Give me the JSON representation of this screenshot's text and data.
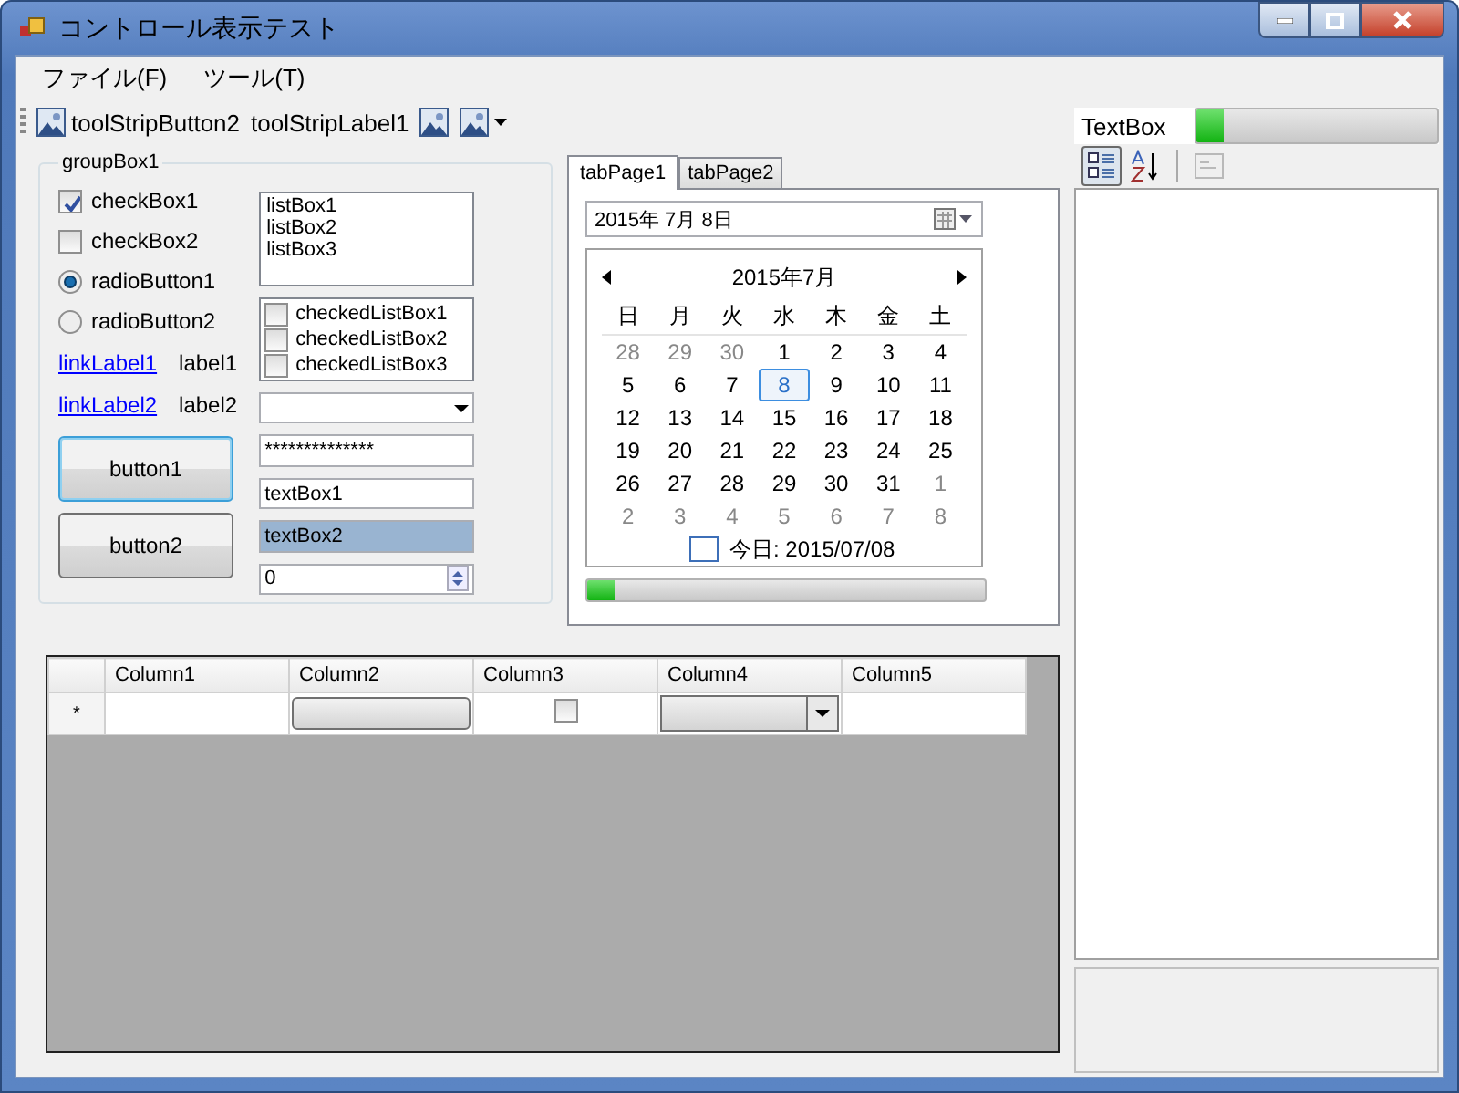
{
  "window": {
    "title": "コントロール表示テスト"
  },
  "menu": [
    {
      "label": "ファイル(F)"
    },
    {
      "label": "ツール(T)"
    }
  ],
  "toolstrip": [
    {
      "kind": "button",
      "label": "toolStripButton2"
    },
    {
      "kind": "label",
      "label": "toolStripLabel1"
    },
    {
      "kind": "image"
    },
    {
      "kind": "dropdown"
    }
  ],
  "group_box": {
    "title": "groupBox1",
    "checkboxes": [
      {
        "label": "checkBox1",
        "checked": true
      },
      {
        "label": "checkBox2",
        "checked": false
      }
    ],
    "radios": [
      {
        "label": "radioButton1",
        "selected": true
      },
      {
        "label": "radioButton2",
        "selected": false
      }
    ],
    "link_rows": [
      {
        "link": "linkLabel1",
        "label": "label1"
      },
      {
        "link": "linkLabel2",
        "label": "label2"
      }
    ],
    "buttons": [
      {
        "label": "button1",
        "focused": true
      },
      {
        "label": "button2",
        "focused": false
      }
    ],
    "list_box": [
      "listBox1",
      "listBox2",
      "listBox3"
    ],
    "checked_list_box": [
      {
        "label": "checkedListBox1",
        "checked": false
      },
      {
        "label": "checkedListBox2",
        "checked": false
      },
      {
        "label": "checkedListBox3",
        "checked": false
      }
    ],
    "password": "**************",
    "text_boxes": [
      {
        "value": "textBox1",
        "selected": false
      },
      {
        "value": "textBox2",
        "selected": true
      }
    ],
    "numeric": "0"
  },
  "tabs": [
    {
      "label": "tabPage1",
      "selected": true
    },
    {
      "label": "tabPage2",
      "selected": false
    }
  ],
  "date_picker": "2015年  7月  8日",
  "calendar": {
    "title": "2015年7月",
    "weekdays": [
      "日",
      "月",
      "火",
      "水",
      "木",
      "金",
      "土"
    ],
    "weeks": [
      [
        {
          "day": "28",
          "other": true,
          "selected": false
        },
        {
          "day": "29",
          "other": true,
          "selected": false
        },
        {
          "day": "30",
          "other": true,
          "selected": false
        },
        {
          "day": "1",
          "other": false,
          "selected": false
        },
        {
          "day": "2",
          "other": false,
          "selected": false
        },
        {
          "day": "3",
          "other": false,
          "selected": false
        },
        {
          "day": "4",
          "other": false,
          "selected": false
        }
      ],
      [
        {
          "day": "5",
          "other": false,
          "selected": false
        },
        {
          "day": "6",
          "other": false,
          "selected": false
        },
        {
          "day": "7",
          "other": false,
          "selected": false
        },
        {
          "day": "8",
          "other": false,
          "selected": true
        },
        {
          "day": "9",
          "other": false,
          "selected": false
        },
        {
          "day": "10",
          "other": false,
          "selected": false
        },
        {
          "day": "11",
          "other": false,
          "selected": false
        }
      ],
      [
        {
          "day": "12",
          "other": false,
          "selected": false
        },
        {
          "day": "13",
          "other": false,
          "selected": false
        },
        {
          "day": "14",
          "other": false,
          "selected": false
        },
        {
          "day": "15",
          "other": false,
          "selected": false
        },
        {
          "day": "16",
          "other": false,
          "selected": false
        },
        {
          "day": "17",
          "other": false,
          "selected": false
        },
        {
          "day": "18",
          "other": false,
          "selected": false
        }
      ],
      [
        {
          "day": "19",
          "other": false,
          "selected": false
        },
        {
          "day": "20",
          "other": false,
          "selected": false
        },
        {
          "day": "21",
          "other": false,
          "selected": false
        },
        {
          "day": "22",
          "other": false,
          "selected": false
        },
        {
          "day": "23",
          "other": false,
          "selected": false
        },
        {
          "day": "24",
          "other": false,
          "selected": false
        },
        {
          "day": "25",
          "other": false,
          "selected": false
        }
      ],
      [
        {
          "day": "26",
          "other": false,
          "selected": false
        },
        {
          "day": "27",
          "other": false,
          "selected": false
        },
        {
          "day": "28",
          "other": false,
          "selected": false
        },
        {
          "day": "29",
          "other": false,
          "selected": false
        },
        {
          "day": "30",
          "other": false,
          "selected": false
        },
        {
          "day": "31",
          "other": false,
          "selected": false
        },
        {
          "day": "1",
          "other": true,
          "selected": false
        }
      ],
      [
        {
          "day": "2",
          "other": true,
          "selected": false
        },
        {
          "day": "3",
          "other": true,
          "selected": false
        },
        {
          "day": "4",
          "other": true,
          "selected": false
        },
        {
          "day": "5",
          "other": true,
          "selected": false
        },
        {
          "day": "6",
          "other": true,
          "selected": false
        },
        {
          "day": "7",
          "other": true,
          "selected": false
        },
        {
          "day": "8",
          "other": true,
          "selected": false
        }
      ]
    ],
    "today": "今日: 2015/07/08"
  },
  "tab_progress": {
    "level": 0.07
  },
  "right_panel": {
    "label": "TextBox",
    "progress": {
      "level": 0.11
    },
    "toolbar": [
      {
        "kind": "categorized",
        "selected": true
      },
      {
        "kind": "alphabetical",
        "selected": false
      },
      {
        "kind": "pages",
        "disabled": true
      }
    ]
  },
  "grid": {
    "columns": [
      "Column1",
      "Column2",
      "Column3",
      "Column4",
      "Column5"
    ],
    "row_header": "*",
    "cells": [
      {
        "kind": "text"
      },
      {
        "kind": "button"
      },
      {
        "kind": "checkbox",
        "checked": false
      },
      {
        "kind": "combo"
      },
      {
        "kind": "text"
      }
    ]
  }
}
